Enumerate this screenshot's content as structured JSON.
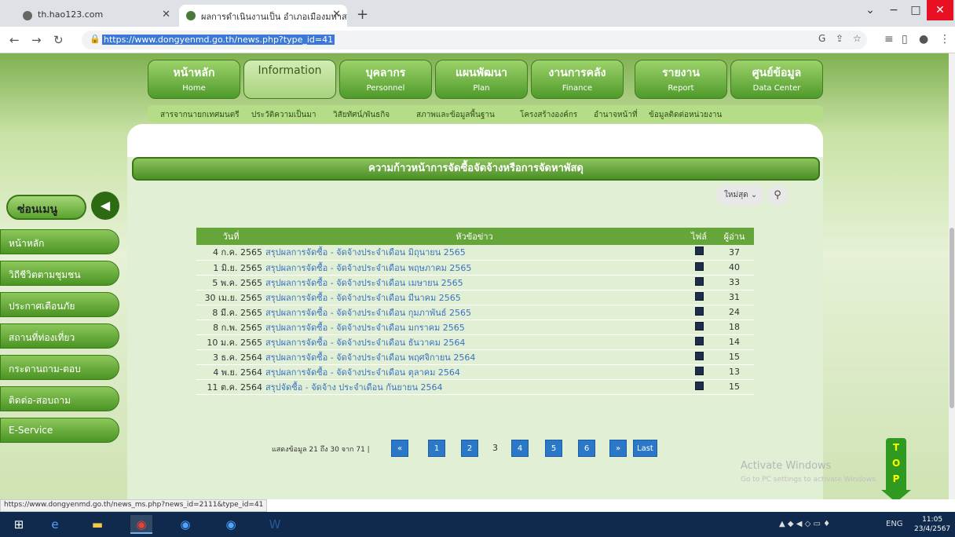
{
  "browser": {
    "tabs": [
      {
        "title": "th.hao123.com"
      },
      {
        "title": "ผลการดำเนินงานเป็น อำเภอเมืองมหาสา"
      }
    ],
    "url": "https://www.dongyenmd.go.th/news.php?type_id=41",
    "status_url": "https://www.dongyenmd.go.th/news_ms.php?news_id=2111&type_id=41"
  },
  "nav": {
    "items": [
      {
        "th": "หน้าหลัก",
        "en": "Home"
      },
      {
        "th": "Information",
        "en": ""
      },
      {
        "th": "บุคลากร",
        "en": "Personnel"
      },
      {
        "th": "แผนพัฒนา",
        "en": "Plan"
      },
      {
        "th": "งานการคลัง",
        "en": "Finance"
      },
      {
        "th": "รายงาน",
        "en": "Report"
      },
      {
        "th": "ศูนย์ข้อมูล",
        "en": "Data Center"
      }
    ],
    "sub_items": [
      "สารจากนายกเทศมนตรี",
      "ประวัติความเป็นมา",
      "วิสัยทัศน์/พันธกิจ",
      "สภาพและข้อมูลพื้นฐาน",
      "โครงสร้างองค์กร",
      "อำนาจหน้าที่",
      "ข้อมูลติดต่อหน่วยงาน"
    ]
  },
  "page": {
    "title": "ความก้าวหน้าการจัดซื้อจัดจ้างหรือการจัดหาพัสดุ",
    "sort_label": "ใหม่สุด"
  },
  "menu": {
    "header": "ซ่อนเมนู",
    "items": [
      "หน้าหลัก",
      "วิถีชีวิตตามชุมชน",
      "ประกาศเตือนภัย",
      "สถานที่ท่องเที่ยว",
      "กระดานถาม-ตอบ",
      "ติดต่อ-สอบถาม",
      "E-Service"
    ]
  },
  "table": {
    "headers": {
      "date": "วันที่",
      "topic": "หัวข้อข่าว",
      "file": "ไฟล์",
      "reads": "ผู้อ่าน"
    },
    "rows": [
      {
        "date": "4 ก.ค. 2565",
        "topic": "สรุปผลการจัดซื้อ - จัดจ้างประจำเดือน มิถุนายน 2565",
        "reads": "37"
      },
      {
        "date": "1 มิ.ย. 2565",
        "topic": "สรุปผลการจัดซื้อ - จัดจ้างประจำเดือน พฤษภาคม 2565",
        "reads": "40"
      },
      {
        "date": "5 พ.ค. 2565",
        "topic": "สรุปผลการจัดซื้อ - จัดจ้างประจำเดือน เมษายน 2565",
        "reads": "33"
      },
      {
        "date": "30 เม.ย. 2565",
        "topic": "สรุปผลการจัดซื้อ - จัดจ้างประจำเดือน มีนาคม 2565",
        "reads": "31"
      },
      {
        "date": "8 มี.ค. 2565",
        "topic": "สรุปผลการจัดซื้อ - จัดจ้างประจำเดือน กุมภาพันธ์ 2565",
        "reads": "24"
      },
      {
        "date": "8 ก.พ. 2565",
        "topic": "สรุปผลการจัดซื้อ - จัดจ้างประจำเดือน มกราคม 2565",
        "reads": "18"
      },
      {
        "date": "10 ม.ค. 2565",
        "topic": "สรุปผลการจัดซื้อ - จัดจ้างประจำเดือน ธันวาคม 2564",
        "reads": "14"
      },
      {
        "date": "3 ธ.ค. 2564",
        "topic": "สรุปผลการจัดซื้อ - จัดจ้างประจำเดือน พฤศจิกายน 2564",
        "reads": "15"
      },
      {
        "date": "4 พ.ย. 2564",
        "topic": "สรุปผลการจัดซื้อ - จัดจ้างประจำเดือน ตุลาคม 2564",
        "reads": "13"
      },
      {
        "date": "11 ต.ค. 2564",
        "topic": "สรุปจัดซื้อ - จัดจ้าง ประจำเดือน กันยายน 2564",
        "reads": "15"
      }
    ]
  },
  "pager": {
    "label": "แสดงข้อมูล 21 ถึง 30 จาก 71 |",
    "prev": "«",
    "pages": [
      "1",
      "2",
      "3",
      "4",
      "5",
      "6"
    ],
    "current": "3",
    "next": "»",
    "last": "Last"
  },
  "watermark": {
    "line1": "Activate Windows",
    "line2": "Go to PC settings to activate Windows."
  },
  "top_button": "TOP",
  "taskbar": {
    "lang": "ENG",
    "time": "11:05",
    "date": "23/4/2567"
  }
}
